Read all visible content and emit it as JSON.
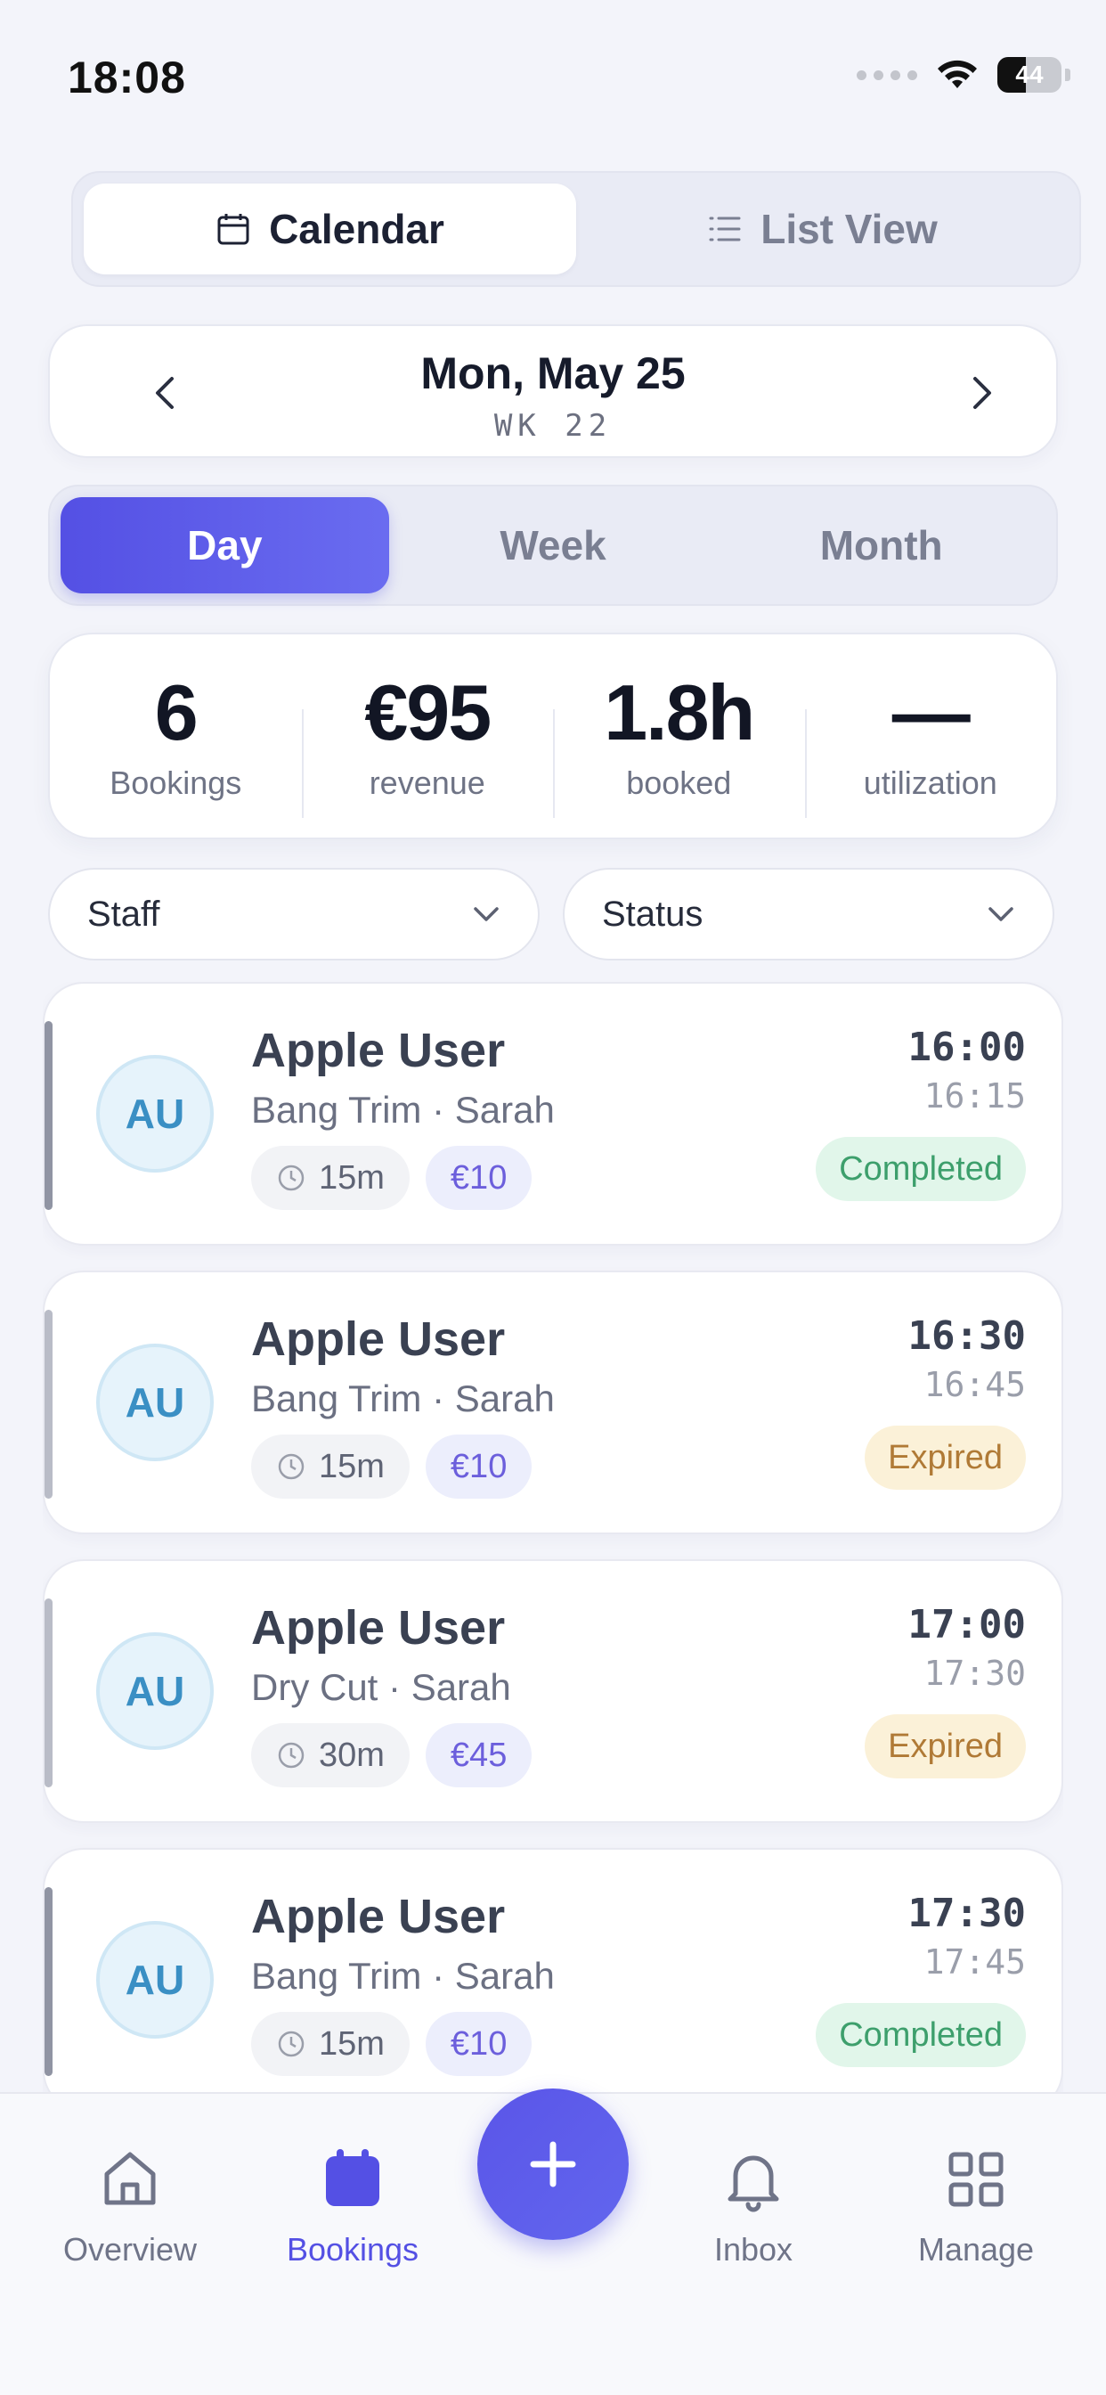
{
  "status_bar": {
    "time": "18:08",
    "battery": "44",
    "battery_level_pct": 44
  },
  "view_toggle": {
    "tabs": [
      {
        "label": "Calendar",
        "icon": "calendar-icon",
        "active": true
      },
      {
        "label": "List View",
        "icon": "list-icon",
        "active": false
      }
    ]
  },
  "date_nav": {
    "title": "Mon, May 25",
    "week": "WK 22"
  },
  "period_toggle": {
    "tabs": [
      "Day",
      "Week",
      "Month"
    ],
    "active": "Day"
  },
  "stats": [
    {
      "value": "6",
      "label": "Bookings"
    },
    {
      "value": "€95",
      "label": "revenue"
    },
    {
      "value": "1.8h",
      "label": "booked"
    },
    {
      "value": "—",
      "label": "utilization"
    }
  ],
  "filters": {
    "staff": "Staff",
    "status": "Status"
  },
  "bookings": [
    {
      "initials": "AU",
      "name": "Apple User",
      "service": "Bang Trim",
      "staff": "Sarah",
      "duration": "15m",
      "price": "€10",
      "start": "16:00",
      "end": "16:15",
      "status": "Completed"
    },
    {
      "initials": "AU",
      "name": "Apple User",
      "service": "Bang Trim",
      "staff": "Sarah",
      "duration": "15m",
      "price": "€10",
      "start": "16:30",
      "end": "16:45",
      "status": "Expired"
    },
    {
      "initials": "AU",
      "name": "Apple User",
      "service": "Dry Cut",
      "staff": "Sarah",
      "duration": "30m",
      "price": "€45",
      "start": "17:00",
      "end": "17:30",
      "status": "Expired"
    },
    {
      "initials": "AU",
      "name": "Apple User",
      "service": "Bang Trim",
      "staff": "Sarah",
      "duration": "15m",
      "price": "€10",
      "start": "17:30",
      "end": "17:45",
      "status": "Completed"
    }
  ],
  "bottom_nav": {
    "items": [
      {
        "label": "Overview",
        "icon": "home-icon"
      },
      {
        "label": "Bookings",
        "icon": "calendar-icon",
        "active": true
      },
      {
        "label": "Inbox",
        "icon": "bell-icon"
      },
      {
        "label": "Manage",
        "icon": "grid-icon"
      }
    ],
    "fab_icon": "plus-icon"
  },
  "colors": {
    "accent": "#5450e4",
    "completed": "#3d9f6c",
    "expired": "#b07a36",
    "background": "#f3f4fa"
  }
}
